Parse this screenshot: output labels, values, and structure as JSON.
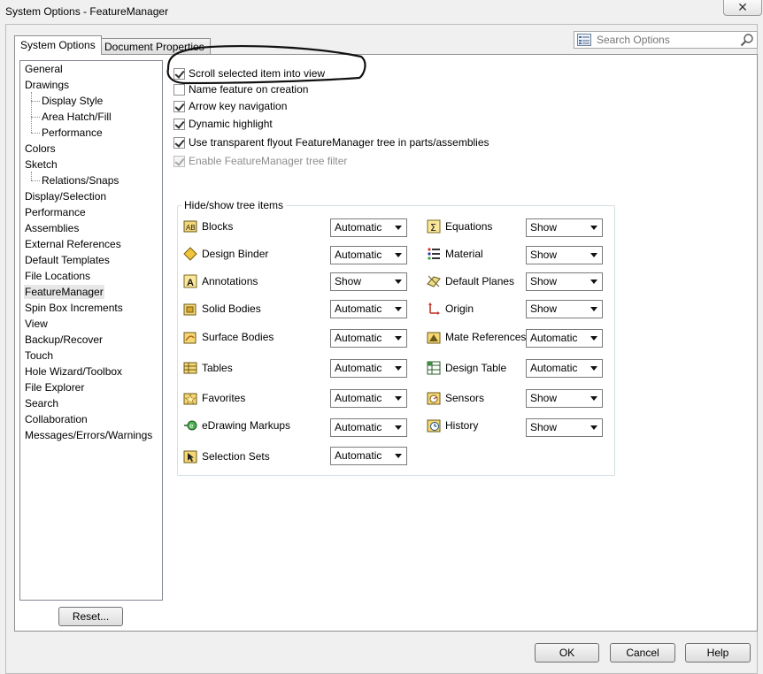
{
  "window": {
    "title": "System Options - FeatureManager",
    "close_glyph": "✕"
  },
  "tabs": [
    {
      "label": "System Options",
      "active": true
    },
    {
      "label": "Document Properties",
      "active": false
    }
  ],
  "search": {
    "placeholder": "Search Options"
  },
  "tree": {
    "items": [
      {
        "label": "General",
        "level": 0
      },
      {
        "label": "Drawings",
        "level": 0
      },
      {
        "label": "Display Style",
        "level": 1
      },
      {
        "label": "Area Hatch/Fill",
        "level": 1
      },
      {
        "label": "Performance",
        "level": 1
      },
      {
        "label": "Colors",
        "level": 0
      },
      {
        "label": "Sketch",
        "level": 0
      },
      {
        "label": "Relations/Snaps",
        "level": 1
      },
      {
        "label": "Display/Selection",
        "level": 0
      },
      {
        "label": "Performance",
        "level": 0
      },
      {
        "label": "Assemblies",
        "level": 0
      },
      {
        "label": "External References",
        "level": 0
      },
      {
        "label": "Default Templates",
        "level": 0
      },
      {
        "label": "File Locations",
        "level": 0
      },
      {
        "label": "FeatureManager",
        "level": 0,
        "selected": true
      },
      {
        "label": "Spin Box Increments",
        "level": 0
      },
      {
        "label": "View",
        "level": 0
      },
      {
        "label": "Backup/Recover",
        "level": 0
      },
      {
        "label": "Touch",
        "level": 0
      },
      {
        "label": "Hole Wizard/Toolbox",
        "level": 0
      },
      {
        "label": "File Explorer",
        "level": 0
      },
      {
        "label": "Search",
        "level": 0
      },
      {
        "label": "Collaboration",
        "level": 0
      },
      {
        "label": "Messages/Errors/Warnings",
        "level": 0
      }
    ]
  },
  "options": [
    {
      "label": "Scroll selected item into view",
      "checked": true,
      "enabled": true
    },
    {
      "label": "Name feature on creation",
      "checked": false,
      "enabled": true
    },
    {
      "label": "Arrow key navigation",
      "checked": true,
      "enabled": true
    },
    {
      "label": "Dynamic highlight",
      "checked": true,
      "enabled": true
    },
    {
      "label": "Use transparent flyout FeatureManager tree in parts/assemblies",
      "checked": true,
      "enabled": true
    },
    {
      "label": "Enable FeatureManager tree filter",
      "checked": true,
      "enabled": false
    }
  ],
  "hide_show": {
    "title": "Hide/show tree items",
    "left": [
      {
        "label": "Blocks",
        "value": "Automatic",
        "icon": "blocks-icon"
      },
      {
        "label": "Design Binder",
        "value": "Automatic",
        "icon": "design-binder-icon"
      },
      {
        "label": "Annotations",
        "value": "Show",
        "icon": "annotations-icon"
      },
      {
        "label": "Solid Bodies",
        "value": "Automatic",
        "icon": "solid-bodies-icon"
      },
      {
        "label": "Surface Bodies",
        "value": "Automatic",
        "icon": "surface-bodies-icon"
      },
      {
        "label": "Tables",
        "value": "Automatic",
        "icon": "tables-icon"
      },
      {
        "label": "Favorites",
        "value": "Automatic",
        "icon": "favorites-icon"
      },
      {
        "label": "eDrawing Markups",
        "value": "Automatic",
        "icon": "edrawing-markups-icon"
      },
      {
        "label": "Selection Sets",
        "value": "Automatic",
        "icon": "selection-sets-icon"
      }
    ],
    "right": [
      {
        "label": "Equations",
        "value": "Show",
        "icon": "equations-icon"
      },
      {
        "label": "Material",
        "value": "Show",
        "icon": "material-icon"
      },
      {
        "label": "Default Planes",
        "value": "Show",
        "icon": "default-planes-icon"
      },
      {
        "label": "Origin",
        "value": "Show",
        "icon": "origin-icon"
      },
      {
        "label": "Mate References",
        "value": "Automatic",
        "icon": "mate-references-icon"
      },
      {
        "label": "Design Table",
        "value": "Automatic",
        "icon": "design-table-icon"
      },
      {
        "label": "Sensors",
        "value": "Show",
        "icon": "sensors-icon"
      },
      {
        "label": "History",
        "value": "Show",
        "icon": "history-icon"
      }
    ]
  },
  "buttons": {
    "reset": "Reset...",
    "ok": "OK",
    "cancel": "Cancel",
    "help": "Help"
  }
}
